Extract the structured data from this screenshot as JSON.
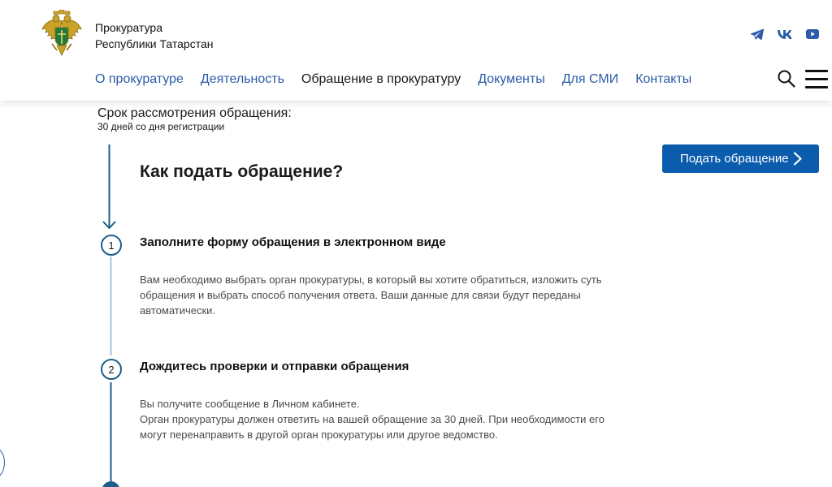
{
  "header": {
    "org_line1": "Прокуратура",
    "org_line2": "Республики Татарстан",
    "social": [
      "telegram-icon",
      "vk-icon",
      "youtube-icon"
    ],
    "nav": [
      {
        "label": "О прокуратуре",
        "active": false
      },
      {
        "label": "Деятельность",
        "active": false
      },
      {
        "label": "Обращение в прокуратуру",
        "active": true
      },
      {
        "label": "Документы",
        "active": false
      },
      {
        "label": "Для СМИ",
        "active": false
      },
      {
        "label": "Контакты",
        "active": false
      }
    ]
  },
  "term": {
    "label": "Срок рассмотрения обращения:",
    "value": "30 дней со дня регистрации"
  },
  "how": {
    "title": "Как подать обращение?",
    "button": "Подать обращение"
  },
  "steps": [
    {
      "number": "1",
      "title": "Заполните форму обращения в электронном виде",
      "text": [
        "Вам необходимо выбрать орган прокуратуры, в который вы хотите обратиться, изложить суть",
        "обращения и выбрать способ получения ответа. Ваши данные для связи будут переданы",
        "автоматически."
      ]
    },
    {
      "number": "2",
      "title": "Дождитесь проверки и отправки обращения",
      "text": [
        "Вы получите сообщение в Личном кабинете.",
        "Орган прокуратуры должен ответить на вашей обращение за 30 дней. При необходимости его",
        "могут перенаправить в другой орган прокуратуры или другое ведомство."
      ]
    }
  ],
  "colors": {
    "nav_link": "#2c5ba8",
    "button": "#0b5cad",
    "timeline": "#1d5e8a"
  }
}
